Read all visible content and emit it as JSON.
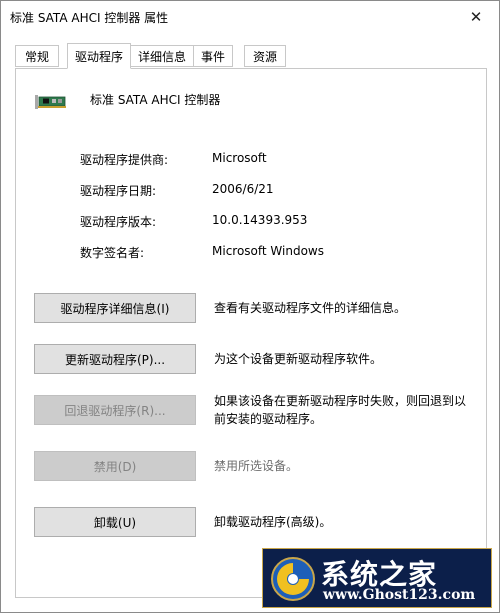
{
  "window": {
    "title": "标准 SATA AHCI 控制器 属性"
  },
  "tabs": [
    {
      "label": "常规"
    },
    {
      "label": "驱动程序"
    },
    {
      "label": "详细信息"
    },
    {
      "label": "事件"
    },
    {
      "label": "资源"
    }
  ],
  "active_tab": "驱动程序",
  "device": {
    "name": "标准 SATA AHCI 控制器",
    "icon": "controller-card-icon"
  },
  "properties": [
    {
      "label": "驱动程序提供商:",
      "value": "Microsoft"
    },
    {
      "label": "驱动程序日期:",
      "value": "2006/6/21"
    },
    {
      "label": "驱动程序版本:",
      "value": "10.0.14393.953"
    },
    {
      "label": "数字签名者:",
      "value": "Microsoft Windows"
    }
  ],
  "actions": [
    {
      "button": "驱动程序详细信息(I)",
      "description": "查看有关驱动程序文件的详细信息。",
      "enabled": true
    },
    {
      "button": "更新驱动程序(P)...",
      "description": "为这个设备更新驱动程序软件。",
      "enabled": true
    },
    {
      "button": "回退驱动程序(R)...",
      "description": "如果该设备在更新驱动程序时失败，则回退到以前安装的驱动程序。",
      "enabled": false
    },
    {
      "button": "禁用(D)",
      "description": "禁用所选设备。",
      "enabled": false
    },
    {
      "button": "卸载(U)",
      "description": "卸载驱动程序(高级)。",
      "enabled": true
    }
  ],
  "watermark": {
    "text": "系统之家",
    "url": "www.Ghost123.com"
  },
  "colors": {
    "button_bg": "#e1e1e1",
    "button_disabled_bg": "#cccccc",
    "watermark_bg": "#0c1f4a"
  }
}
